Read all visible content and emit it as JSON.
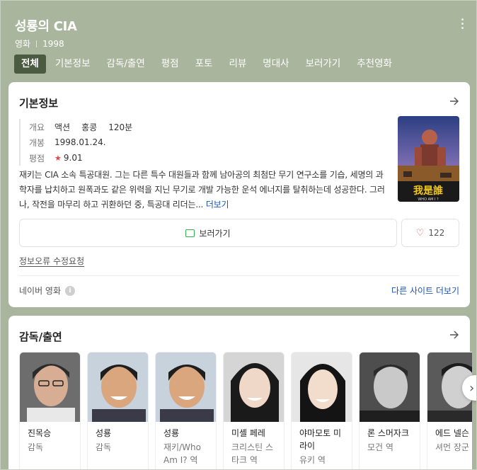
{
  "header": {
    "title": "성룡의 CIA",
    "category": "영화",
    "year": "1998"
  },
  "tabs": [
    {
      "label": "전체",
      "active": true
    },
    {
      "label": "기본정보"
    },
    {
      "label": "감독/출연"
    },
    {
      "label": "평점"
    },
    {
      "label": "포토"
    },
    {
      "label": "리뷰"
    },
    {
      "label": "명대사"
    },
    {
      "label": "보러가기"
    },
    {
      "label": "추천영화"
    }
  ],
  "basic": {
    "title": "기본정보",
    "overview_label": "개요",
    "genre": "액션",
    "country": "홍콩",
    "runtime": "120분",
    "release_label": "개봉",
    "release_date": "1998.01.24.",
    "rating_label": "평점",
    "rating": "9.01",
    "poster_text": "我是誰",
    "poster_sub": "WHO AM I ?",
    "description": "재키는 CIA 소속 특공대원. 그는 다른 특수 대원들과 함께 남아공의 최첨단 무기 연구소를 기습, 세명의 과학자를 납치하고 원폭과도 같은 위력을 지닌 무기로 개발 가능한 운석 에너지를 탈취하는데 성공한다. 그러나, 작전을 마무리 하고 귀환하던 중, 특공대 리더는...",
    "more": "더보기",
    "watch_label": "보러가기",
    "like_count": "122",
    "report_label": "정보오류 수정요청",
    "source_label": "네이버 영화",
    "other_sites": "다른 사이트 더보기"
  },
  "cast": {
    "title": "감독/출연",
    "people": [
      {
        "name": "진목승",
        "role": "감독"
      },
      {
        "name": "성룡",
        "role": "감독"
      },
      {
        "name": "성룡",
        "role": "재키/Who Am I? 역"
      },
      {
        "name": "미셸 페레",
        "role": "크리스틴 스타크 역"
      },
      {
        "name": "야마모토 미라이",
        "role": "유키 역"
      },
      {
        "name": "론 스머자크",
        "role": "모건 역"
      },
      {
        "name": "에드 넬슨",
        "role": "셔먼 장군 역"
      }
    ]
  },
  "colors": {
    "header_bg": "#a9b59d",
    "active_tab": "#4b5b42",
    "link": "#1a56b7",
    "star": "#e64545"
  }
}
